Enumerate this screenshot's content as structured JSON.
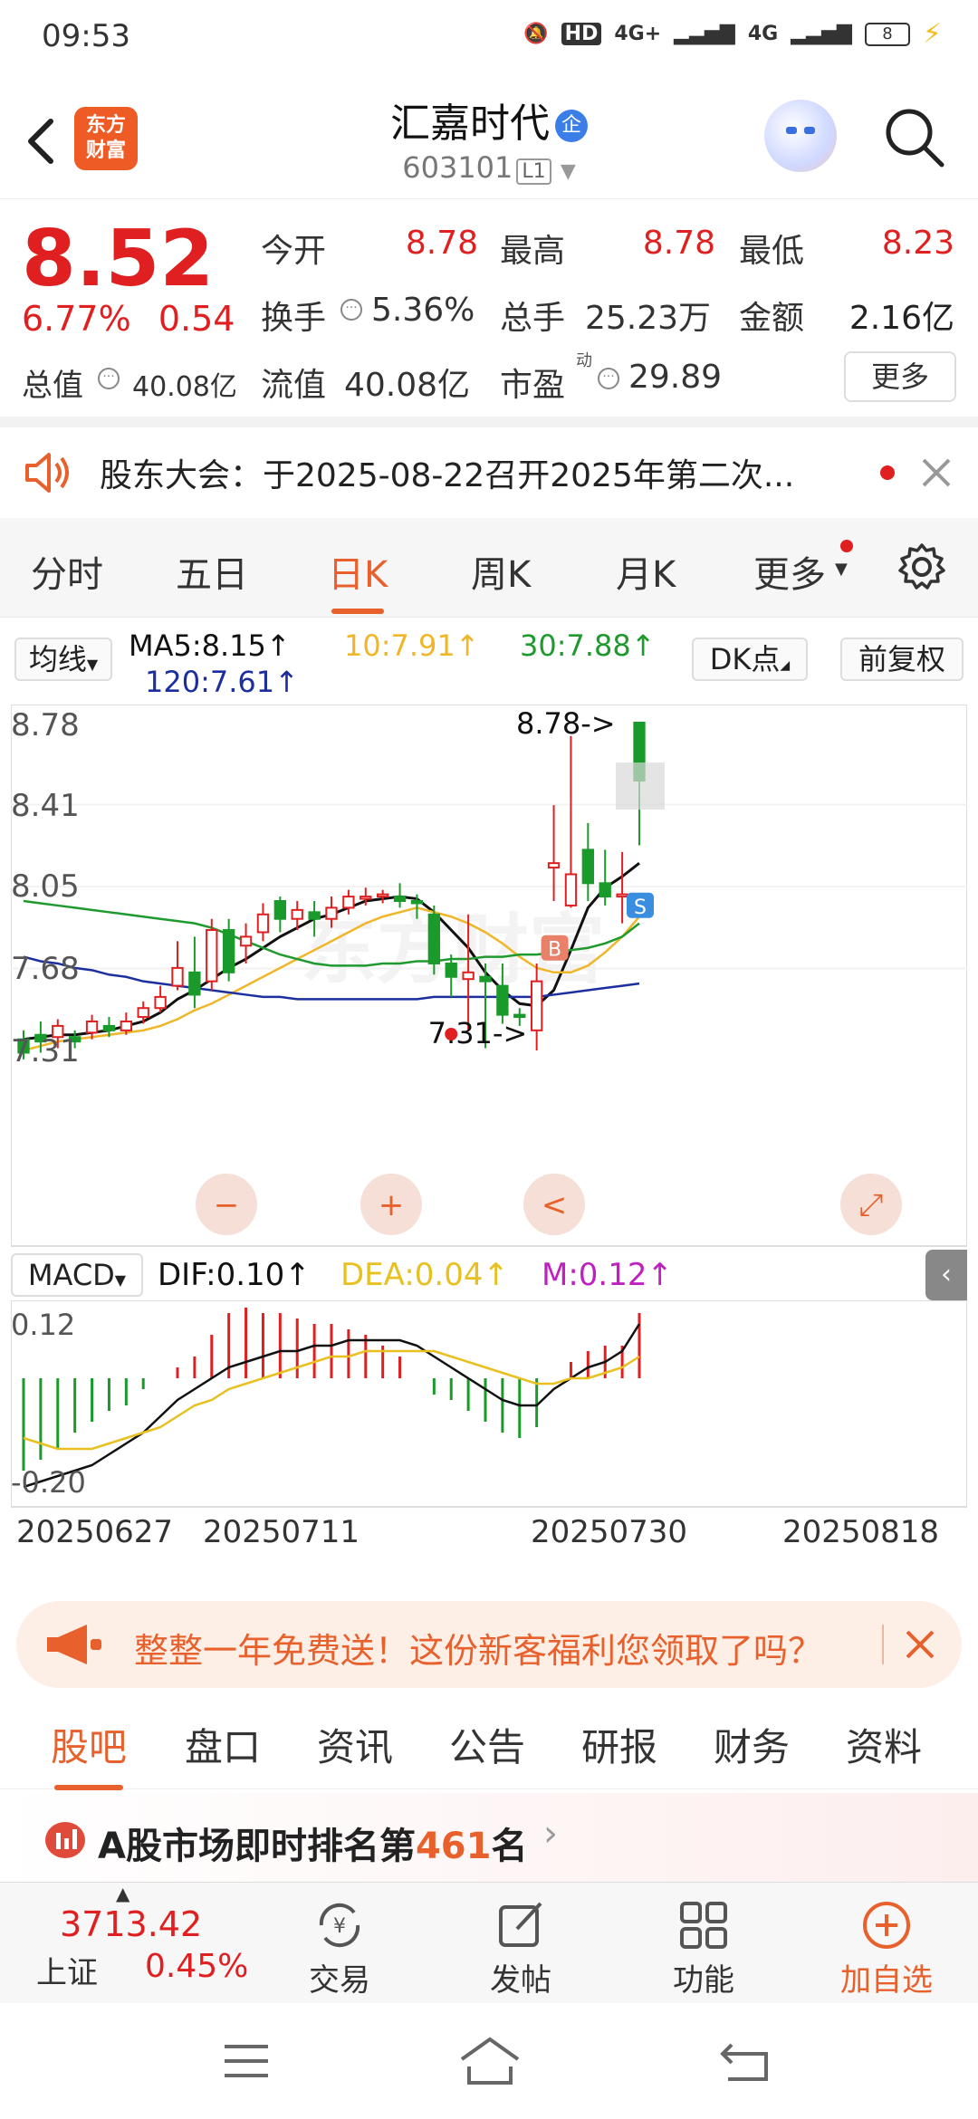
{
  "status_bar": {
    "time": "09:53",
    "network1": "4G+",
    "network2": "4G",
    "battery": "8"
  },
  "header": {
    "logo_line1": "东方",
    "logo_line2": "财富",
    "title": "汇嘉时代",
    "title_badge": "企",
    "code": "603101",
    "level": "L1"
  },
  "quote": {
    "price": "8.52",
    "change_pct": "6.77%",
    "change_amt": "0.54",
    "open_label": "今开",
    "open": "8.78",
    "high_label": "最高",
    "high": "8.78",
    "low_label": "最低",
    "low": "8.23",
    "turnover_label": "换手",
    "turnover": "5.36%",
    "volume_label": "总手",
    "volume": "25.23万",
    "amount_label": "金额",
    "amount": "2.16亿",
    "mktcap_label": "总值",
    "mktcap": "40.08亿",
    "float_label": "流值",
    "float_cap": "40.08亿",
    "pe_label": "市盈",
    "pe_sup": "动",
    "pe": "29.89",
    "more_label": "更多"
  },
  "notice": {
    "text": "股东大会：于2025-08-22召开2025年第二次..."
  },
  "chart_tabs": [
    "分时",
    "五日",
    "日K",
    "周K",
    "月K",
    "更多"
  ],
  "ma_bar": {
    "ma_label": "均线",
    "ma5": "MA5:8.15↑",
    "ma10": "10:7.91↑",
    "ma30": "30:7.88↑",
    "ma120": "120:7.61↑",
    "dk_label": "DK点",
    "fq_label": "前复权"
  },
  "macd_bar": {
    "label": "MACD",
    "dif": "DIF:0.10↑",
    "dea": "DEA:0.04↑",
    "m": "M:0.12↑"
  },
  "chart_data": [
    {
      "type": "candlestick",
      "y_ticks": [
        "8.78",
        "8.41",
        "8.05",
        "7.68",
        "7.31"
      ],
      "ylim": [
        7.31,
        8.78
      ],
      "annotations": [
        "8.78->",
        "7.31->",
        "S",
        "B"
      ],
      "candles": [
        {
          "o": 7.36,
          "c": 7.3,
          "h": 7.4,
          "l": 7.27
        },
        {
          "o": 7.38,
          "c": 7.35,
          "h": 7.44,
          "l": 7.3
        },
        {
          "o": 7.37,
          "c": 7.42,
          "h": 7.45,
          "l": 7.32
        },
        {
          "o": 7.37,
          "c": 7.35,
          "h": 7.4,
          "l": 7.32
        },
        {
          "o": 7.39,
          "c": 7.44,
          "h": 7.47,
          "l": 7.36
        },
        {
          "o": 7.42,
          "c": 7.4,
          "h": 7.46,
          "l": 7.37
        },
        {
          "o": 7.4,
          "c": 7.44,
          "h": 7.48,
          "l": 7.38
        },
        {
          "o": 7.46,
          "c": 7.5,
          "h": 7.53,
          "l": 7.43
        },
        {
          "o": 7.5,
          "c": 7.55,
          "h": 7.6,
          "l": 7.48
        },
        {
          "o": 7.6,
          "c": 7.68,
          "h": 7.8,
          "l": 7.58
        },
        {
          "o": 7.66,
          "c": 7.56,
          "h": 7.82,
          "l": 7.5
        },
        {
          "o": 7.62,
          "c": 7.85,
          "h": 7.9,
          "l": 7.58
        },
        {
          "o": 7.85,
          "c": 7.66,
          "h": 7.9,
          "l": 7.62
        },
        {
          "o": 7.78,
          "c": 7.82,
          "h": 7.88,
          "l": 7.7
        },
        {
          "o": 7.84,
          "c": 7.92,
          "h": 7.97,
          "l": 7.8
        },
        {
          "o": 7.98,
          "c": 7.9,
          "h": 8.0,
          "l": 7.84
        },
        {
          "o": 7.9,
          "c": 7.94,
          "h": 7.98,
          "l": 7.85
        },
        {
          "o": 7.93,
          "c": 7.9,
          "h": 7.98,
          "l": 7.82
        },
        {
          "o": 7.9,
          "c": 7.95,
          "h": 8.0,
          "l": 7.86
        },
        {
          "o": 7.95,
          "c": 8.0,
          "h": 8.03,
          "l": 7.92
        },
        {
          "o": 7.99,
          "c": 8.0,
          "h": 8.04,
          "l": 7.96
        },
        {
          "o": 8.0,
          "c": 8.01,
          "h": 8.03,
          "l": 7.97
        },
        {
          "o": 8.0,
          "c": 7.98,
          "h": 8.06,
          "l": 7.95
        },
        {
          "o": 7.98,
          "c": 7.97,
          "h": 8.01,
          "l": 7.9
        },
        {
          "o": 7.92,
          "c": 7.7,
          "h": 7.96,
          "l": 7.65
        },
        {
          "o": 7.7,
          "c": 7.64,
          "h": 7.74,
          "l": 7.55
        },
        {
          "o": 7.63,
          "c": 7.66,
          "h": 7.92,
          "l": 7.4
        },
        {
          "o": 7.64,
          "c": 7.62,
          "h": 7.7,
          "l": 7.32
        },
        {
          "o": 7.6,
          "c": 7.47,
          "h": 7.7,
          "l": 7.43
        },
        {
          "o": 7.47,
          "c": 7.46,
          "h": 7.5,
          "l": 7.42
        },
        {
          "o": 7.4,
          "c": 7.62,
          "h": 7.7,
          "l": 7.31
        },
        {
          "o": 8.13,
          "c": 8.15,
          "h": 8.41,
          "l": 7.98
        },
        {
          "o": 7.96,
          "c": 8.1,
          "h": 8.72,
          "l": 7.95
        },
        {
          "o": 8.21,
          "c": 8.06,
          "h": 8.33,
          "l": 7.98
        },
        {
          "o": 8.06,
          "c": 8.0,
          "h": 8.21,
          "l": 7.96
        },
        {
          "o": 8.0,
          "c": 8.01,
          "h": 8.2,
          "l": 7.88
        },
        {
          "o": 8.78,
          "c": 8.52,
          "h": 8.78,
          "l": 8.23
        }
      ],
      "series": [
        {
          "name": "MA5",
          "values": [
            7.36,
            7.37,
            7.38,
            7.38,
            7.39,
            7.4,
            7.42,
            7.44,
            7.48,
            7.54,
            7.58,
            7.63,
            7.68,
            7.72,
            7.77,
            7.82,
            7.86,
            7.9,
            7.92,
            7.95,
            7.98,
            7.99,
            8.0,
            7.99,
            7.93,
            7.85,
            7.77,
            7.66,
            7.58,
            7.52,
            7.51,
            7.58,
            7.76,
            7.95,
            8.04,
            8.09,
            8.15
          ]
        },
        {
          "name": "10",
          "values": [
            7.31,
            7.33,
            7.35,
            7.36,
            7.37,
            7.38,
            7.39,
            7.4,
            7.42,
            7.45,
            7.49,
            7.52,
            7.56,
            7.6,
            7.64,
            7.68,
            7.72,
            7.76,
            7.8,
            7.84,
            7.88,
            7.91,
            7.93,
            7.95,
            7.93,
            7.91,
            7.88,
            7.84,
            7.79,
            7.73,
            7.68,
            7.66,
            7.66,
            7.69,
            7.75,
            7.82,
            7.91
          ]
        },
        {
          "name": "30",
          "values": [
            7.98,
            7.97,
            7.96,
            7.95,
            7.94,
            7.93,
            7.92,
            7.91,
            7.9,
            7.89,
            7.88,
            7.86,
            7.83,
            7.8,
            7.77,
            7.74,
            7.72,
            7.7,
            7.69,
            7.69,
            7.69,
            7.7,
            7.7,
            7.71,
            7.71,
            7.72,
            7.72,
            7.73,
            7.73,
            7.74,
            7.74,
            7.75,
            7.76,
            7.77,
            7.79,
            7.82,
            7.88
          ]
        },
        {
          "name": "120",
          "values": [
            7.73,
            7.71,
            7.7,
            7.68,
            7.67,
            7.65,
            7.64,
            7.62,
            7.61,
            7.6,
            7.59,
            7.58,
            7.57,
            7.56,
            7.55,
            7.55,
            7.54,
            7.54,
            7.54,
            7.54,
            7.54,
            7.54,
            7.54,
            7.54,
            7.55,
            7.55,
            7.55,
            7.55,
            7.55,
            7.55,
            7.55,
            7.56,
            7.57,
            7.58,
            7.59,
            7.6,
            7.61
          ]
        }
      ]
    },
    {
      "type": "bar",
      "name": "MACD",
      "y_ticks": [
        "0.12",
        "-0.20"
      ],
      "ylim": [
        -0.2,
        0.12
      ],
      "values": [
        -0.17,
        -0.15,
        -0.13,
        -0.1,
        -0.08,
        -0.06,
        -0.05,
        -0.02,
        0.0,
        0.02,
        0.04,
        0.08,
        0.12,
        0.13,
        0.12,
        0.12,
        0.11,
        0.1,
        0.1,
        0.09,
        0.08,
        0.06,
        0.04,
        0.0,
        -0.03,
        -0.04,
        -0.06,
        -0.08,
        -0.1,
        -0.11,
        -0.09,
        0.0,
        0.03,
        0.05,
        0.06,
        0.06,
        0.12
      ],
      "series": [
        {
          "name": "DIF",
          "values": [
            -0.2,
            -0.19,
            -0.18,
            -0.17,
            -0.16,
            -0.14,
            -0.12,
            -0.1,
            -0.07,
            -0.04,
            -0.02,
            0.0,
            0.02,
            0.03,
            0.04,
            0.05,
            0.05,
            0.06,
            0.06,
            0.07,
            0.07,
            0.07,
            0.07,
            0.06,
            0.04,
            0.02,
            0.0,
            -0.02,
            -0.04,
            -0.05,
            -0.05,
            -0.02,
            0.0,
            0.02,
            0.03,
            0.05,
            0.1
          ]
        },
        {
          "name": "DEA",
          "values": [
            -0.11,
            -0.12,
            -0.13,
            -0.13,
            -0.13,
            -0.12,
            -0.11,
            -0.1,
            -0.09,
            -0.07,
            -0.05,
            -0.04,
            -0.02,
            -0.01,
            0.0,
            0.01,
            0.02,
            0.03,
            0.04,
            0.04,
            0.05,
            0.05,
            0.05,
            0.05,
            0.05,
            0.04,
            0.03,
            0.02,
            0.01,
            0.0,
            -0.01,
            -0.01,
            0.0,
            0.0,
            0.01,
            0.02,
            0.04
          ]
        }
      ]
    }
  ],
  "dates": [
    "20250627",
    "20250711",
    "20250730",
    "20250818"
  ],
  "chart_controls": {
    "minus": "−",
    "plus": "+",
    "prev": "<",
    "expand": "⤢"
  },
  "promo": {
    "text": "整整一年免费送！这份新客福利您领取了吗？"
  },
  "bottom_tabs": [
    "股吧",
    "盘口",
    "资讯",
    "公告",
    "研报",
    "财务",
    "资料"
  ],
  "rank": {
    "prefix": "A股市场即时排名第",
    "rank": "461",
    "suffix": "名"
  },
  "bottom_bar": {
    "index_value": "3713.42",
    "index_name": "上证",
    "index_change": "0.45%",
    "trade": "交易",
    "post": "发帖",
    "function": "功能",
    "add": "加自选"
  },
  "colors": {
    "up": "#e02020",
    "down": "#1a9a2a",
    "accent": "#e8612c",
    "ma5": "#111111",
    "ma10": "#f0b62a",
    "ma30": "#1f9a2f",
    "ma120": "#1c2f9e",
    "dea": "#e8c020",
    "m": "#c020c0"
  }
}
